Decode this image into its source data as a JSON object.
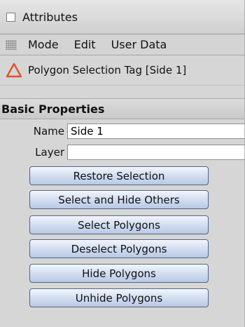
{
  "window": {
    "title": "Attributes"
  },
  "menu": {
    "items": [
      "Mode",
      "Edit",
      "User Data"
    ]
  },
  "tag": {
    "label": "Polygon Selection Tag [Side 1]",
    "icon": "triangle-warning-icon",
    "icon_color": "#e0532b"
  },
  "section": {
    "title": "Basic Properties"
  },
  "fields": {
    "name": {
      "label": "Name",
      "value": "Side 1"
    },
    "layer": {
      "label": "Layer",
      "value": ""
    }
  },
  "buttons": [
    "Restore Selection",
    "Select and Hide Others",
    "Select Polygons",
    "Deselect Polygons",
    "Hide Polygons",
    "Unhide Polygons"
  ]
}
